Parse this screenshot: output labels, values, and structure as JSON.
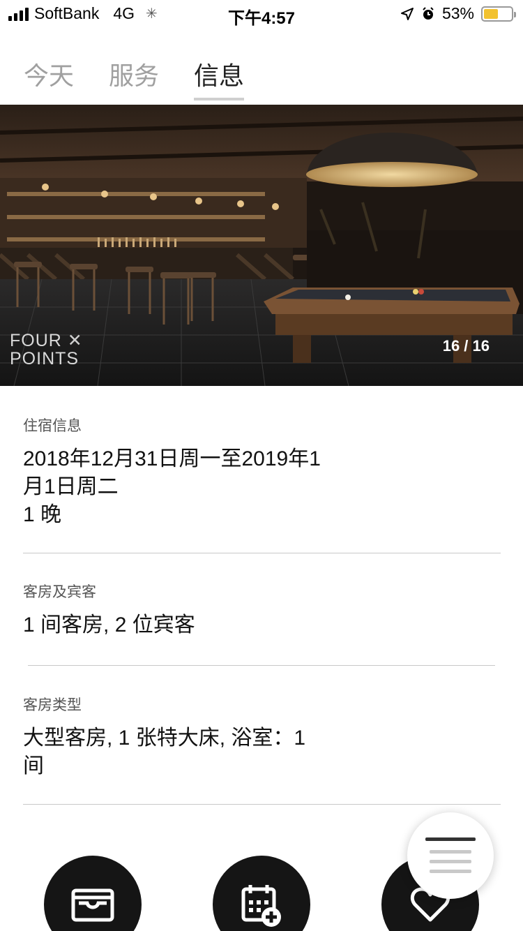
{
  "status_bar": {
    "carrier": "SoftBank",
    "network": "4G",
    "time": "下午4:57",
    "battery_percent": "53%",
    "battery_level": 0.53
  },
  "tabs": [
    {
      "label": "今天",
      "active": false
    },
    {
      "label": "服务",
      "active": false
    },
    {
      "label": "信息",
      "active": true
    }
  ],
  "hero": {
    "logo_line1": "FOUR",
    "logo_line2": "POINTS",
    "counter": "16 / 16"
  },
  "stay": {
    "label": "住宿信息",
    "dates_line1": "2018年12月31日周一至2019年1",
    "dates_line2": "月1日周二",
    "nights": "1 晚"
  },
  "rooms_guests": {
    "label": "客房及宾客",
    "value": "1 间客房, 2 位宾客"
  },
  "room_type": {
    "label": "客房类型",
    "value_line1": "大型客房, 1  张特大床, 浴室：1",
    "value_line2": "间"
  },
  "actions": [
    {
      "icon": "wallet-icon"
    },
    {
      "icon": "calendar-add-icon"
    },
    {
      "icon": "heart-icon"
    }
  ],
  "menu_icon": "menu-icon",
  "colors": {
    "battery": "#f2c230",
    "action_bg": "#151515"
  }
}
